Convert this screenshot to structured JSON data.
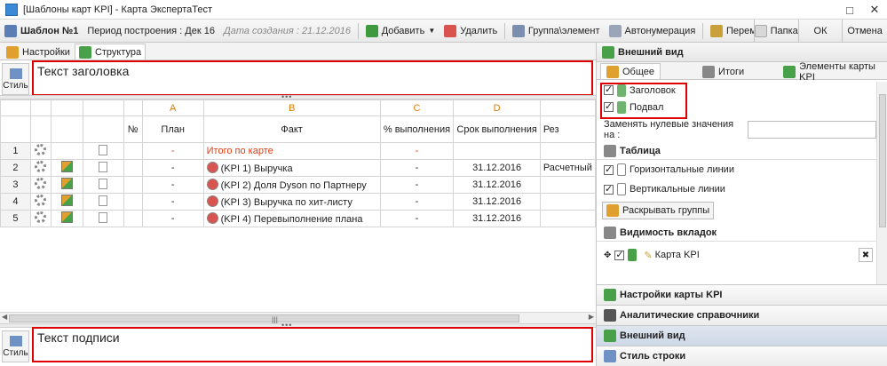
{
  "window": {
    "title": "[Шаблоны карт KPI] - Карта ЭкспертаТест"
  },
  "toolbar": {
    "template_name": "Шаблон №1",
    "period_label": "Период построения : Дек 16",
    "created_label": "Дата создания : 21.12.2016",
    "add_label": "Добавить",
    "delete_label": "Удалить",
    "group_label": "Группа\\элемент",
    "autonum_label": "Автонумерация",
    "move_label": "Перемещен",
    "folder_label": "Папка",
    "ok_label": "ОК",
    "cancel_label": "Отмена"
  },
  "tabs": {
    "settings": "Настройки",
    "structure": "Структура"
  },
  "header_text": "Текст заголовка",
  "footer_text": "Текст подписи",
  "style_label": "Стиль",
  "grid": {
    "letters": [
      "A",
      "B",
      "C",
      "D"
    ],
    "headers": {
      "num": "№",
      "plan": "План",
      "fact": "Факт",
      "pct": "% выполнения",
      "deadline": "Срок выполнения",
      "res": "Рез"
    },
    "rows": [
      {
        "n": "1",
        "plan": "-",
        "fact": "Итого по карте",
        "pct": "-",
        "date": "",
        "res": ""
      },
      {
        "n": "2",
        "plan": "-",
        "fact": "(KPI 1) Выручка",
        "pct": "-",
        "date": "31.12.2016",
        "res": "Расчетный"
      },
      {
        "n": "3",
        "plan": "-",
        "fact": "(KPI 2) Доля Dyson по Партнеру",
        "pct": "-",
        "date": "31.12.2016",
        "res": ""
      },
      {
        "n": "4",
        "plan": "-",
        "fact": "(KPI 3) Выручка по хит-листу",
        "pct": "-",
        "date": "31.12.2016",
        "res": ""
      },
      {
        "n": "5",
        "plan": "-",
        "fact": "(KPI 4) Перевыполнение плана",
        "pct": "-",
        "date": "31.12.2016",
        "res": ""
      }
    ]
  },
  "panel": {
    "title": "Внешний вид",
    "tabs": [
      "Общее",
      "Итоги",
      "Элементы карты KPI"
    ],
    "header_check": "Заголовок",
    "footer_check": "Подвал",
    "zero_label": "Заменять нулевые значения на :",
    "zero_value": "",
    "table_section": "Таблица",
    "hlines": "Горизонтальные линии",
    "vlines": "Вертикальные линии",
    "expand_groups": "Раскрывать группы",
    "visibility_section": "Видимость вкладок",
    "kpi_card": "Карта KPI"
  },
  "accordion": [
    "Настройки карты KPI",
    "Аналитические справочники",
    "Внешний вид",
    "Стиль строки"
  ],
  "colors": {
    "highlight_border": "#e00000",
    "letter_header": "#e07b00",
    "total_text": "#e03c14"
  }
}
